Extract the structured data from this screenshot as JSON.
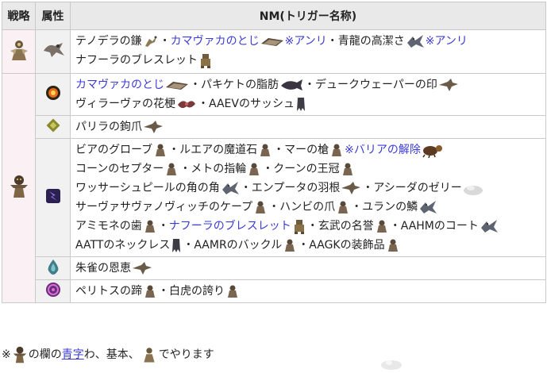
{
  "header": {
    "strategy": "戦略",
    "attribute": "属性",
    "nm": "NM(トリガー名称)"
  },
  "rows": [
    {
      "lines": [
        [
          {
            "t": "テノデラの鎌",
            "icon": "mantis-icon"
          },
          {
            "t": "・"
          },
          {
            "t": "カマヴァカのとじ",
            "blue": true,
            "icon": "book-icon"
          },
          {
            "t": "※アンリ",
            "blue": true
          },
          {
            "t": "・青龍の高潔さ",
            "icon": "dragon-icon"
          },
          {
            "t": "※アンリ",
            "blue": true
          }
        ],
        [
          {
            "t": "ナフーラのブレスレット",
            "icon": "golem-icon"
          }
        ]
      ]
    },
    {
      "lines": [
        [
          {
            "t": "カマヴァカのとじ",
            "blue": true,
            "icon": "book-icon"
          },
          {
            "t": "・パキケトの脂肪",
            "icon": "whale-icon"
          },
          {
            "t": "・デュークウェーパーの印",
            "icon": "bird-icon"
          }
        ],
        [
          {
            "t": "ヴィラーヴァの花梗",
            "icon": "flower-icon"
          },
          {
            "t": "・AAEVのサッシュ",
            "icon": "ghost-icon"
          }
        ]
      ]
    },
    {
      "lines": [
        [
          {
            "t": "パリラの鉤爪",
            "icon": "bird-icon"
          }
        ]
      ]
    },
    {
      "lines": [
        [
          {
            "t": "ビアのグローブ",
            "icon": "beast-icon"
          },
          {
            "t": "・ルエアの魔道石",
            "icon": "beast-icon"
          },
          {
            "t": "・マーの槍",
            "icon": "beast-icon"
          },
          {
            "t": "※バリアの解除",
            "blue": true,
            "icon": "bug-icon"
          }
        ],
        [
          {
            "t": "コーンのセプター",
            "icon": "beast-icon"
          },
          {
            "t": "・メトの指輪",
            "icon": "beast-icon"
          },
          {
            "t": "・クーンの王冠",
            "icon": "beast-icon"
          }
        ],
        [
          {
            "t": "ワッサーシュピールの角の角",
            "icon": "dragon-icon"
          },
          {
            "t": "・エンプータの羽根",
            "icon": "bird-icon"
          },
          {
            "t": "・アシーダのゼリー",
            "icon": "slime-icon"
          }
        ],
        [
          {
            "t": "サーヴァサヴァノヴィッチのケープ",
            "icon": "beast-icon"
          },
          {
            "t": "・ハンビの爪",
            "icon": "beast-icon"
          },
          {
            "t": "・ユランの鱗",
            "icon": "dragon-icon"
          }
        ],
        [
          {
            "t": "アミモネの歯",
            "icon": "beast-icon"
          },
          {
            "t": "・"
          },
          {
            "t": "ナフーラのブレスレット",
            "blue": true,
            "icon": "golem-icon"
          },
          {
            "t": "・玄武の名誉",
            "icon": "beast-icon"
          },
          {
            "t": "・AAHMのコート",
            "icon": "dragon-icon"
          }
        ],
        [
          {
            "t": "AATTのネックレス",
            "icon": "ghost-icon"
          },
          {
            "t": "・AAMRのバックル",
            "icon": "beast-icon"
          },
          {
            "t": "・AAGKの装飾品",
            "icon": "beast-icon"
          }
        ]
      ]
    },
    {
      "lines": [
        [
          {
            "t": "朱雀の恩恵",
            "icon": "bird-icon"
          }
        ]
      ]
    },
    {
      "lines": [
        [
          {
            "t": "ペリトスの蹄",
            "icon": "beast-icon"
          },
          {
            "t": "・白虎の誇り",
            "icon": "beast-icon"
          }
        ]
      ]
    }
  ],
  "note": {
    "prefix": "※",
    "mid": "の欄の",
    "link": "青字",
    "suffix": "わ、基本、",
    "end": "でやります"
  },
  "colors": {
    "blue_text": "#3b3bd6",
    "header_bg": "#e9e9e9",
    "col1_bg": "#fbf1f4",
    "col2_bg": "#f1f1f1",
    "border": "#c9c9c9"
  }
}
